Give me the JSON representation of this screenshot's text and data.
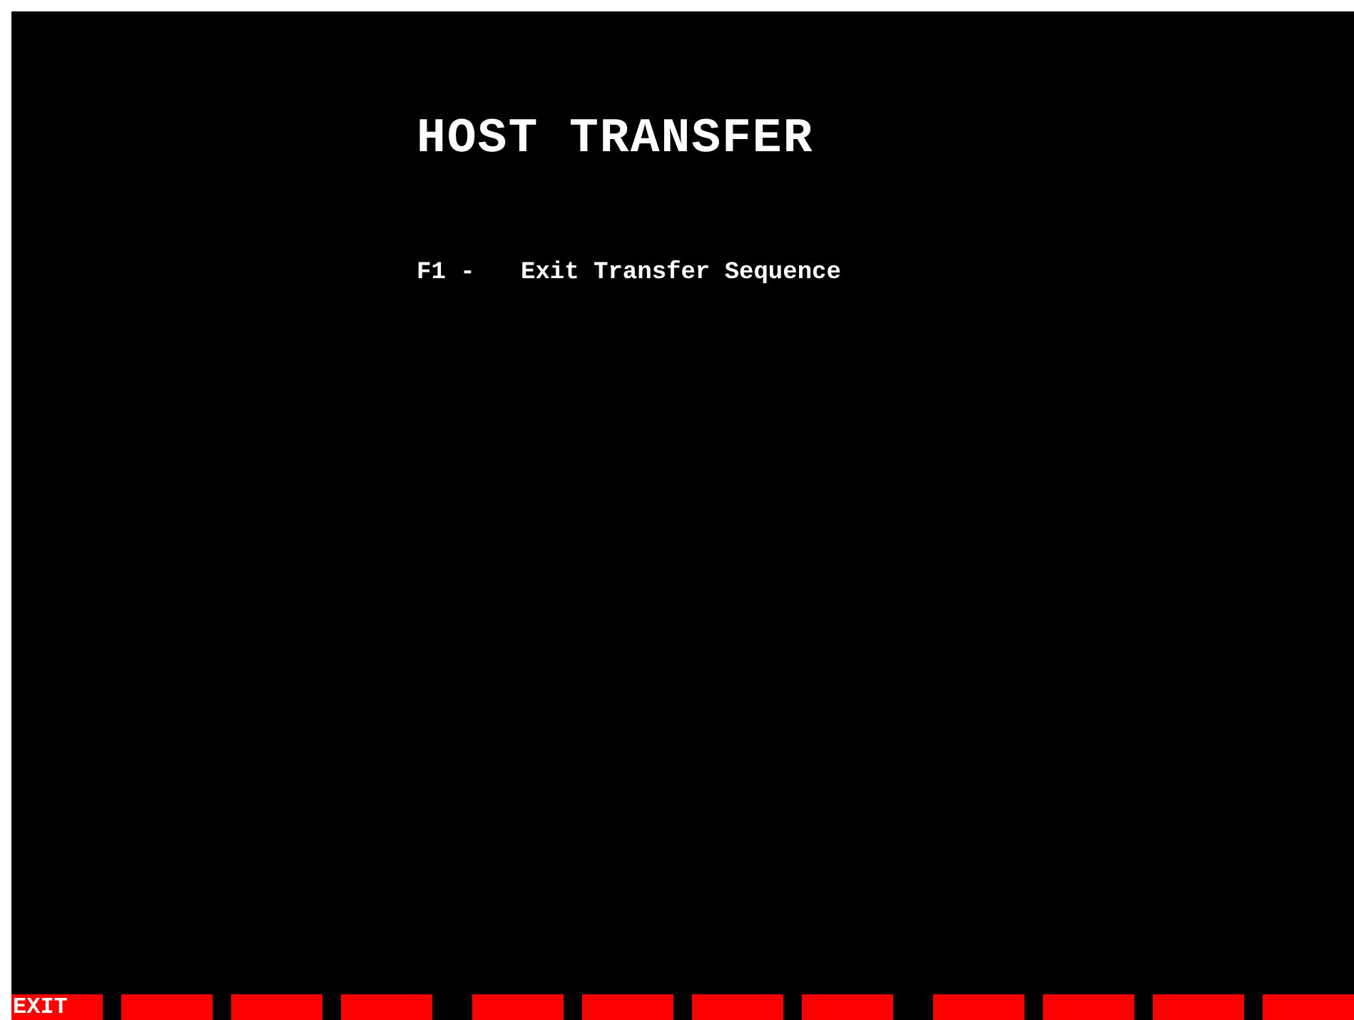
{
  "title": "HOST TRANSFER",
  "options": [
    {
      "key": "F1 -",
      "text": "Exit Transfer Sequence"
    }
  ],
  "function_keys": [
    {
      "kind": "labeled",
      "label": "EXIT"
    },
    {
      "kind": "blank"
    },
    {
      "kind": "blank"
    },
    {
      "kind": "blank"
    },
    {
      "kind": "blank"
    },
    {
      "kind": "blank"
    },
    {
      "kind": "blank"
    },
    {
      "kind": "blank"
    },
    {
      "kind": "blank"
    },
    {
      "kind": "blank"
    },
    {
      "kind": "blank"
    },
    {
      "kind": "blank"
    }
  ]
}
